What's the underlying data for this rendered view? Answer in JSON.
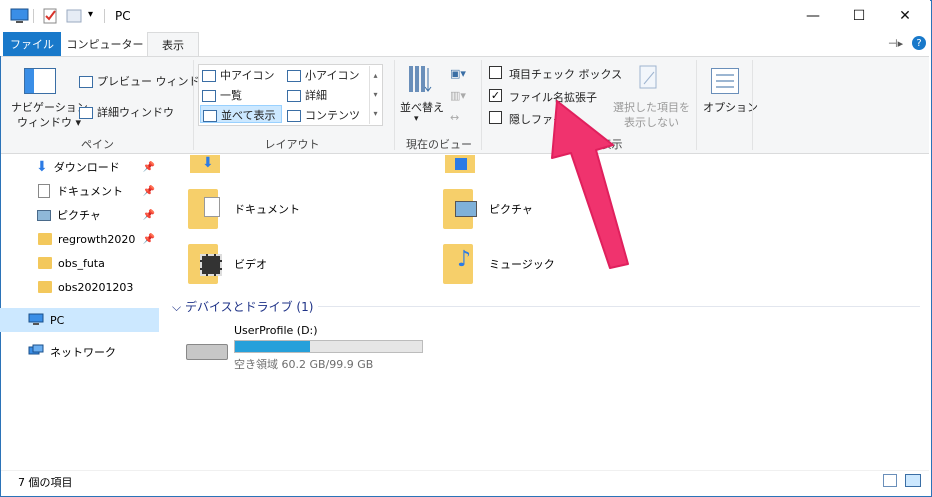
{
  "window": {
    "title": "PC",
    "controls": {
      "minimize": "—",
      "maximize": "☐",
      "close": "✕"
    }
  },
  "tabs": {
    "file": "ファイル",
    "computer": "コンピューター",
    "view": "表示"
  },
  "ribbon": {
    "pane": {
      "nav_pane_line1": "ナビゲーション",
      "nav_pane_line2": "ウィンドウ",
      "preview": "プレビュー ウィンドウ",
      "details": "詳細ウィンドウ",
      "label": "ペイン"
    },
    "layout": {
      "medium_icons": "中アイコン",
      "small_icons": "小アイコン",
      "list": "一覧",
      "details": "詳細",
      "tiles": "並べて表示",
      "content": "コンテンツ",
      "label": "レイアウト"
    },
    "current_view": {
      "sort_by": "並べ替え",
      "label": "現在のビュー"
    },
    "show_hide": {
      "item_checkboxes": "項目チェック ボックス",
      "file_extensions": "ファイル名拡張子",
      "hidden_items": "隠しファイル",
      "hide_selected_line1": "選択した項目を",
      "hide_selected_line2": "表示しない",
      "label": "非表示",
      "file_extensions_checked": true
    },
    "options": "オプション"
  },
  "nav": {
    "items": [
      {
        "label": "ダウンロード",
        "icon": "download-icon",
        "pinned": true
      },
      {
        "label": "ドキュメント",
        "icon": "document-icon",
        "pinned": true
      },
      {
        "label": "ピクチャ",
        "icon": "pictures-icon",
        "pinned": true
      },
      {
        "label": "regrowth2020",
        "icon": "folder-icon",
        "pinned": true
      },
      {
        "label": "obs_futa",
        "icon": "folder-icon",
        "pinned": false
      },
      {
        "label": "obs20201203",
        "icon": "folder-icon",
        "pinned": false
      }
    ],
    "pc": "PC",
    "network": "ネットワーク"
  },
  "content": {
    "folders": [
      {
        "label": "ドキュメント"
      },
      {
        "label": "ピクチャ"
      },
      {
        "label": "ビデオ"
      },
      {
        "label": "ミュージック"
      }
    ],
    "devices_header": "デバイスとドライブ (1)",
    "drive": {
      "name": "UserProfile (D:)",
      "free_text": "空き領域 60.2 GB/99.9 GB",
      "used_fraction": 0.4
    }
  },
  "status": {
    "item_count": "7 個の項目"
  },
  "colors": {
    "accent": "#1979ca",
    "arrow": "#f0336e",
    "drive_bar": "#26a0da"
  }
}
